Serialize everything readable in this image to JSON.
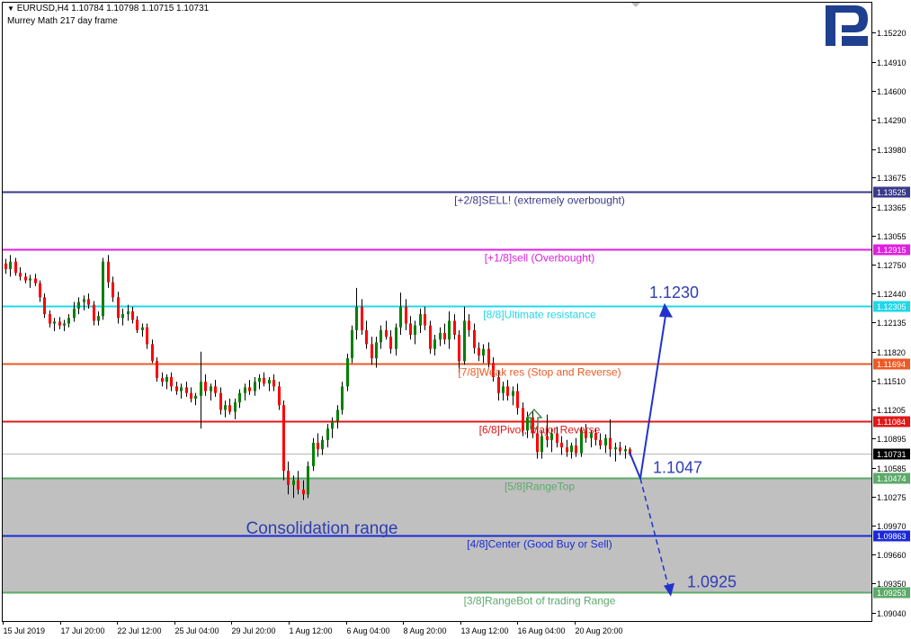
{
  "header": {
    "symbol_line": "EURUSD,H4  1.10784 1.10798 1.10715 1.10731",
    "indicator": "Murrey Math 217 day frame"
  },
  "colors": {
    "bull": "#008000",
    "bear": "#ff0000",
    "wick": "#000000",
    "logo": "#1f3f8f",
    "arrow": "#2a2fbf"
  },
  "chart_data": {
    "type": "candlestick",
    "symbol": "EURUSD",
    "timeframe": "H4",
    "ylim": [
      1.0895,
      1.1554
    ],
    "y_ticks": [
      1.1522,
      1.1491,
      1.146,
      1.1429,
      1.1398,
      1.13675,
      1.13365,
      1.13055,
      1.1275,
      1.1244,
      1.12135,
      1.1182,
      1.1151,
      1.11205,
      1.10895,
      1.10585,
      1.10275,
      1.0997,
      1.0966,
      1.0935,
      1.0904
    ],
    "x_ticks": [
      "15 Jul 2019",
      "17 Jul 20:00",
      "22 Jul 12:00",
      "25 Jul 04:00",
      "29 Jul 20:00",
      "1 Aug 12:00",
      "6 Aug 04:00",
      "8 Aug 20:00",
      "13 Aug 12:00",
      "16 Aug 04:00",
      "20 Aug 20:00"
    ],
    "levels": [
      {
        "label": "[+2/8]SELL! (extremely overbought)",
        "price": 1.13525,
        "price_text": "1.13525",
        "color": "#3a3a8a"
      },
      {
        "label": "[+1/8]sell (Overbought)",
        "price": 1.12915,
        "price_text": "1.12915",
        "color": "#e020e0"
      },
      {
        "label": "[8/8]Ultimate resistance",
        "price": 1.12305,
        "price_text": "1.12305",
        "color": "#20d8e8"
      },
      {
        "label": "[7/8]Weak res (Stop and Reverse)",
        "price": 1.11694,
        "price_text": "1.11694",
        "color": "#ee5a24"
      },
      {
        "label": "[6/8]Pivot, Major Reverse",
        "price": 1.11084,
        "price_text": "1.11084",
        "color": "#e01818"
      },
      {
        "label": "[5/8]RangeTop",
        "price": 1.10474,
        "price_text": "1.10474",
        "color": "#5caa6a"
      },
      {
        "label": "[4/8]Center (Good Buy or Sell)",
        "price": 1.09863,
        "price_text": "1.09863",
        "color": "#1a2ad8"
      },
      {
        "label": "[3/8]RangeBot of trading Range",
        "price": 1.09253,
        "price_text": "1.09253",
        "color": "#5caa6a"
      }
    ],
    "current_price": 1.10731,
    "current_price_text": "1.10731",
    "consolidation": {
      "label": "Consolidation range",
      "from": 1.09253,
      "to": 1.10474
    },
    "targets": [
      {
        "label": "1.1230",
        "price": 1.123
      },
      {
        "label": "1.1047",
        "price": 1.1047
      },
      {
        "label": "1.0925",
        "price": 1.0925
      }
    ],
    "candles": [
      {
        "o": 1.1276,
        "h": 1.1281,
        "l": 1.1265,
        "c": 1.127
      },
      {
        "o": 1.127,
        "h": 1.1285,
        "l": 1.1262,
        "c": 1.1278
      },
      {
        "o": 1.1278,
        "h": 1.1282,
        "l": 1.1263,
        "c": 1.1266
      },
      {
        "o": 1.1266,
        "h": 1.1272,
        "l": 1.1258,
        "c": 1.1262
      },
      {
        "o": 1.1262,
        "h": 1.1266,
        "l": 1.1255,
        "c": 1.1258
      },
      {
        "o": 1.1258,
        "h": 1.1264,
        "l": 1.125,
        "c": 1.126
      },
      {
        "o": 1.126,
        "h": 1.1265,
        "l": 1.1252,
        "c": 1.1255
      },
      {
        "o": 1.1255,
        "h": 1.1258,
        "l": 1.1235,
        "c": 1.124
      },
      {
        "o": 1.124,
        "h": 1.1244,
        "l": 1.1218,
        "c": 1.1222
      },
      {
        "o": 1.1222,
        "h": 1.1226,
        "l": 1.1208,
        "c": 1.1212
      },
      {
        "o": 1.1212,
        "h": 1.1218,
        "l": 1.1204,
        "c": 1.1214
      },
      {
        "o": 1.1214,
        "h": 1.1219,
        "l": 1.1206,
        "c": 1.121
      },
      {
        "o": 1.121,
        "h": 1.1216,
        "l": 1.1204,
        "c": 1.1212
      },
      {
        "o": 1.1212,
        "h": 1.1222,
        "l": 1.1208,
        "c": 1.1218
      },
      {
        "o": 1.1218,
        "h": 1.1235,
        "l": 1.1214,
        "c": 1.1228
      },
      {
        "o": 1.1228,
        "h": 1.124,
        "l": 1.1222,
        "c": 1.1235
      },
      {
        "o": 1.1235,
        "h": 1.1242,
        "l": 1.1226,
        "c": 1.1238
      },
      {
        "o": 1.1238,
        "h": 1.1244,
        "l": 1.1228,
        "c": 1.1232
      },
      {
        "o": 1.1232,
        "h": 1.1236,
        "l": 1.121,
        "c": 1.1215
      },
      {
        "o": 1.1215,
        "h": 1.1225,
        "l": 1.121,
        "c": 1.122
      },
      {
        "o": 1.122,
        "h": 1.1282,
        "l": 1.1216,
        "c": 1.1278
      },
      {
        "o": 1.1278,
        "h": 1.1285,
        "l": 1.125,
        "c": 1.1256
      },
      {
        "o": 1.1256,
        "h": 1.1262,
        "l": 1.1235,
        "c": 1.124
      },
      {
        "o": 1.124,
        "h": 1.1246,
        "l": 1.1212,
        "c": 1.1218
      },
      {
        "o": 1.1218,
        "h": 1.1228,
        "l": 1.121,
        "c": 1.1222
      },
      {
        "o": 1.1222,
        "h": 1.1232,
        "l": 1.1215,
        "c": 1.1225
      },
      {
        "o": 1.1225,
        "h": 1.123,
        "l": 1.1212,
        "c": 1.1216
      },
      {
        "o": 1.1216,
        "h": 1.122,
        "l": 1.1202,
        "c": 1.1205
      },
      {
        "o": 1.1205,
        "h": 1.1212,
        "l": 1.1198,
        "c": 1.1208
      },
      {
        "o": 1.1208,
        "h": 1.1212,
        "l": 1.1185,
        "c": 1.119
      },
      {
        "o": 1.119,
        "h": 1.1195,
        "l": 1.117,
        "c": 1.1172
      },
      {
        "o": 1.1172,
        "h": 1.1176,
        "l": 1.115,
        "c": 1.1154
      },
      {
        "o": 1.1154,
        "h": 1.116,
        "l": 1.1145,
        "c": 1.115
      },
      {
        "o": 1.115,
        "h": 1.1158,
        "l": 1.1142,
        "c": 1.1155
      },
      {
        "o": 1.1155,
        "h": 1.116,
        "l": 1.114,
        "c": 1.1145
      },
      {
        "o": 1.1145,
        "h": 1.115,
        "l": 1.1136,
        "c": 1.114
      },
      {
        "o": 1.114,
        "h": 1.1148,
        "l": 1.1132,
        "c": 1.1144
      },
      {
        "o": 1.1144,
        "h": 1.115,
        "l": 1.1134,
        "c": 1.1138
      },
      {
        "o": 1.1138,
        "h": 1.1144,
        "l": 1.1128,
        "c": 1.1132
      },
      {
        "o": 1.1132,
        "h": 1.1138,
        "l": 1.1125,
        "c": 1.1135
      },
      {
        "o": 1.1135,
        "h": 1.1182,
        "l": 1.11,
        "c": 1.115
      },
      {
        "o": 1.115,
        "h": 1.1158,
        "l": 1.1135,
        "c": 1.114
      },
      {
        "o": 1.114,
        "h": 1.1148,
        "l": 1.113,
        "c": 1.1145
      },
      {
        "o": 1.1145,
        "h": 1.1152,
        "l": 1.1134,
        "c": 1.1138
      },
      {
        "o": 1.1138,
        "h": 1.1144,
        "l": 1.1115,
        "c": 1.112
      },
      {
        "o": 1.112,
        "h": 1.113,
        "l": 1.1112,
        "c": 1.1125
      },
      {
        "o": 1.1125,
        "h": 1.1132,
        "l": 1.1115,
        "c": 1.1118
      },
      {
        "o": 1.1118,
        "h": 1.1132,
        "l": 1.111,
        "c": 1.1128
      },
      {
        "o": 1.1128,
        "h": 1.1142,
        "l": 1.1122,
        "c": 1.1138
      },
      {
        "o": 1.1138,
        "h": 1.1148,
        "l": 1.113,
        "c": 1.1144
      },
      {
        "o": 1.1144,
        "h": 1.1152,
        "l": 1.1136,
        "c": 1.114
      },
      {
        "o": 1.114,
        "h": 1.1155,
        "l": 1.1135,
        "c": 1.115
      },
      {
        "o": 1.115,
        "h": 1.1158,
        "l": 1.1142,
        "c": 1.1154
      },
      {
        "o": 1.1154,
        "h": 1.116,
        "l": 1.1145,
        "c": 1.1148
      },
      {
        "o": 1.1148,
        "h": 1.1155,
        "l": 1.114,
        "c": 1.1152
      },
      {
        "o": 1.1152,
        "h": 1.1158,
        "l": 1.114,
        "c": 1.1145
      },
      {
        "o": 1.1145,
        "h": 1.115,
        "l": 1.112,
        "c": 1.1125
      },
      {
        "o": 1.1125,
        "h": 1.113,
        "l": 1.1045,
        "c": 1.1055
      },
      {
        "o": 1.1055,
        "h": 1.1065,
        "l": 1.103,
        "c": 1.104
      },
      {
        "o": 1.104,
        "h": 1.105,
        "l": 1.1026,
        "c": 1.1045
      },
      {
        "o": 1.1045,
        "h": 1.1055,
        "l": 1.103,
        "c": 1.1035
      },
      {
        "o": 1.1035,
        "h": 1.1045,
        "l": 1.1024,
        "c": 1.103
      },
      {
        "o": 1.103,
        "h": 1.1065,
        "l": 1.1026,
        "c": 1.106
      },
      {
        "o": 1.106,
        "h": 1.109,
        "l": 1.1055,
        "c": 1.1085
      },
      {
        "o": 1.1085,
        "h": 1.1095,
        "l": 1.107,
        "c": 1.1078
      },
      {
        "o": 1.1078,
        "h": 1.1092,
        "l": 1.1072,
        "c": 1.1088
      },
      {
        "o": 1.1088,
        "h": 1.1105,
        "l": 1.108,
        "c": 1.11
      },
      {
        "o": 1.11,
        "h": 1.1112,
        "l": 1.109,
        "c": 1.1108
      },
      {
        "o": 1.1108,
        "h": 1.1125,
        "l": 1.11,
        "c": 1.112
      },
      {
        "o": 1.112,
        "h": 1.115,
        "l": 1.1115,
        "c": 1.1145
      },
      {
        "o": 1.1145,
        "h": 1.118,
        "l": 1.114,
        "c": 1.1175
      },
      {
        "o": 1.1175,
        "h": 1.121,
        "l": 1.117,
        "c": 1.1205
      },
      {
        "o": 1.1205,
        "h": 1.125,
        "l": 1.1195,
        "c": 1.123
      },
      {
        "o": 1.123,
        "h": 1.1238,
        "l": 1.12,
        "c": 1.1205
      },
      {
        "o": 1.1205,
        "h": 1.1215,
        "l": 1.1185,
        "c": 1.119
      },
      {
        "o": 1.119,
        "h": 1.1198,
        "l": 1.1168,
        "c": 1.1175
      },
      {
        "o": 1.1175,
        "h": 1.1198,
        "l": 1.1165,
        "c": 1.1192
      },
      {
        "o": 1.1192,
        "h": 1.121,
        "l": 1.1185,
        "c": 1.1205
      },
      {
        "o": 1.1205,
        "h": 1.1215,
        "l": 1.1195,
        "c": 1.1198
      },
      {
        "o": 1.1198,
        "h": 1.1205,
        "l": 1.118,
        "c": 1.1185
      },
      {
        "o": 1.1185,
        "h": 1.1212,
        "l": 1.1178,
        "c": 1.1208
      },
      {
        "o": 1.1208,
        "h": 1.1245,
        "l": 1.12,
        "c": 1.123
      },
      {
        "o": 1.123,
        "h": 1.1238,
        "l": 1.1205,
        "c": 1.1212
      },
      {
        "o": 1.1212,
        "h": 1.122,
        "l": 1.1195,
        "c": 1.12
      },
      {
        "o": 1.12,
        "h": 1.1215,
        "l": 1.119,
        "c": 1.121
      },
      {
        "o": 1.121,
        "h": 1.1228,
        "l": 1.1202,
        "c": 1.1222
      },
      {
        "o": 1.1222,
        "h": 1.123,
        "l": 1.1205,
        "c": 1.121
      },
      {
        "o": 1.121,
        "h": 1.1215,
        "l": 1.118,
        "c": 1.1185
      },
      {
        "o": 1.1185,
        "h": 1.12,
        "l": 1.1178,
        "c": 1.1195
      },
      {
        "o": 1.1195,
        "h": 1.1208,
        "l": 1.1188,
        "c": 1.1202
      },
      {
        "o": 1.1202,
        "h": 1.1212,
        "l": 1.119,
        "c": 1.1195
      },
      {
        "o": 1.1195,
        "h": 1.1225,
        "l": 1.1185,
        "c": 1.1215
      },
      {
        "o": 1.1215,
        "h": 1.1222,
        "l": 1.1195,
        "c": 1.12
      },
      {
        "o": 1.12,
        "h": 1.1205,
        "l": 1.116,
        "c": 1.1172
      },
      {
        "o": 1.1172,
        "h": 1.123,
        "l": 1.1168,
        "c": 1.1215
      },
      {
        "o": 1.1215,
        "h": 1.1222,
        "l": 1.1198,
        "c": 1.1205
      },
      {
        "o": 1.1205,
        "h": 1.1212,
        "l": 1.118,
        "c": 1.1186
      },
      {
        "o": 1.1186,
        "h": 1.1192,
        "l": 1.1172,
        "c": 1.1178
      },
      {
        "o": 1.1178,
        "h": 1.119,
        "l": 1.117,
        "c": 1.1185
      },
      {
        "o": 1.1185,
        "h": 1.1192,
        "l": 1.1165,
        "c": 1.117
      },
      {
        "o": 1.117,
        "h": 1.1176,
        "l": 1.115,
        "c": 1.1155
      },
      {
        "o": 1.1155,
        "h": 1.1162,
        "l": 1.113,
        "c": 1.1138
      },
      {
        "o": 1.1138,
        "h": 1.115,
        "l": 1.113,
        "c": 1.1145
      },
      {
        "o": 1.1145,
        "h": 1.1152,
        "l": 1.113,
        "c": 1.1135
      },
      {
        "o": 1.1135,
        "h": 1.1145,
        "l": 1.1125,
        "c": 1.114
      },
      {
        "o": 1.114,
        "h": 1.1148,
        "l": 1.1115,
        "c": 1.1122
      },
      {
        "o": 1.1122,
        "h": 1.1128,
        "l": 1.1092,
        "c": 1.1098
      },
      {
        "o": 1.1098,
        "h": 1.1118,
        "l": 1.109,
        "c": 1.1112
      },
      {
        "o": 1.1112,
        "h": 1.1118,
        "l": 1.109,
        "c": 1.1095
      },
      {
        "o": 1.1095,
        "h": 1.11,
        "l": 1.1068,
        "c": 1.1075
      },
      {
        "o": 1.1075,
        "h": 1.1098,
        "l": 1.1068,
        "c": 1.1092
      },
      {
        "o": 1.1092,
        "h": 1.1115,
        "l": 1.108,
        "c": 1.1088
      },
      {
        "o": 1.1088,
        "h": 1.11,
        "l": 1.1075,
        "c": 1.1095
      },
      {
        "o": 1.1095,
        "h": 1.1102,
        "l": 1.108,
        "c": 1.1085
      },
      {
        "o": 1.1085,
        "h": 1.1092,
        "l": 1.1072,
        "c": 1.108
      },
      {
        "o": 1.108,
        "h": 1.1088,
        "l": 1.107,
        "c": 1.1075
      },
      {
        "o": 1.1075,
        "h": 1.1085,
        "l": 1.1068,
        "c": 1.1082
      },
      {
        "o": 1.1082,
        "h": 1.109,
        "l": 1.107,
        "c": 1.1074
      },
      {
        "o": 1.1074,
        "h": 1.1102,
        "l": 1.107,
        "c": 1.1098
      },
      {
        "o": 1.1098,
        "h": 1.1105,
        "l": 1.1085,
        "c": 1.109
      },
      {
        "o": 1.109,
        "h": 1.1098,
        "l": 1.108,
        "c": 1.1095
      },
      {
        "o": 1.1095,
        "h": 1.11,
        "l": 1.1082,
        "c": 1.1088
      },
      {
        "o": 1.1088,
        "h": 1.1095,
        "l": 1.1078,
        "c": 1.1082
      },
      {
        "o": 1.1082,
        "h": 1.1094,
        "l": 1.1074,
        "c": 1.109
      },
      {
        "o": 1.109,
        "h": 1.111,
        "l": 1.107,
        "c": 1.1078
      },
      {
        "o": 1.1078,
        "h": 1.1085,
        "l": 1.1065,
        "c": 1.108
      },
      {
        "o": 1.108,
        "h": 1.1086,
        "l": 1.1072,
        "c": 1.1076
      },
      {
        "o": 1.1076,
        "h": 1.1082,
        "l": 1.1068,
        "c": 1.1078
      },
      {
        "o": 1.1078,
        "h": 1.108,
        "l": 1.1071,
        "c": 1.1073
      }
    ]
  }
}
